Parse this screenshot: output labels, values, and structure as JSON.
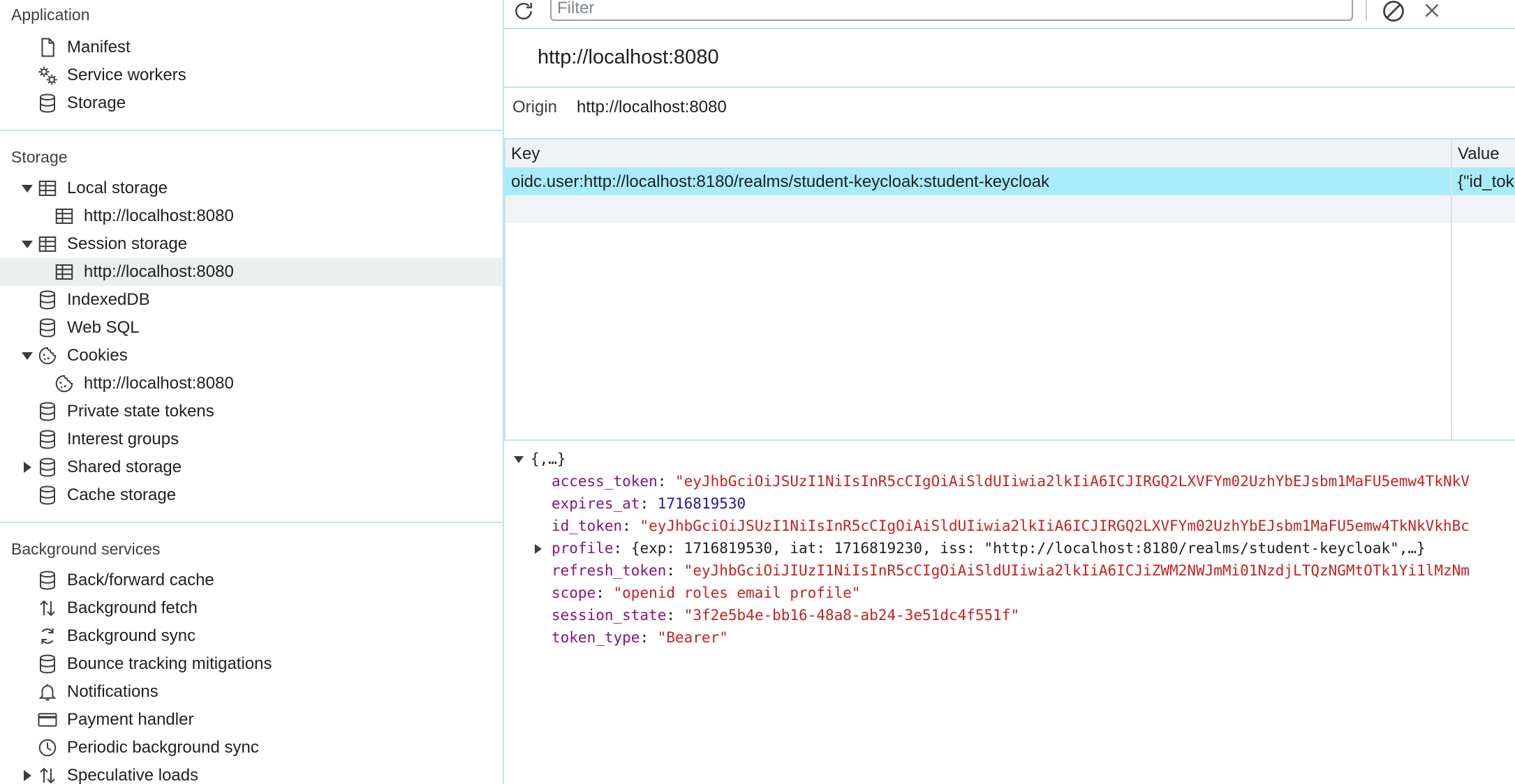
{
  "sidebar": {
    "application": {
      "title": "Application",
      "items": [
        {
          "label": "Manifest",
          "icon": "document-icon"
        },
        {
          "label": "Service workers",
          "icon": "gears-icon"
        },
        {
          "label": "Storage",
          "icon": "database-icon"
        }
      ]
    },
    "storage": {
      "title": "Storage",
      "local_storage": {
        "label": "Local storage",
        "child": "http://localhost:8080"
      },
      "session_storage": {
        "label": "Session storage",
        "child": "http://localhost:8080"
      },
      "indexeddb": "IndexedDB",
      "websql": "Web SQL",
      "cookies": {
        "label": "Cookies",
        "child": "http://localhost:8080"
      },
      "private_state_tokens": "Private state tokens",
      "interest_groups": "Interest groups",
      "shared_storage": "Shared storage",
      "cache_storage": "Cache storage"
    },
    "background": {
      "title": "Background services",
      "items": [
        {
          "label": "Back/forward cache",
          "icon": "database-icon"
        },
        {
          "label": "Background fetch",
          "icon": "updown-arrows-icon"
        },
        {
          "label": "Background sync",
          "icon": "sync-icon"
        },
        {
          "label": "Bounce tracking mitigations",
          "icon": "database-icon"
        },
        {
          "label": "Notifications",
          "icon": "bell-icon"
        },
        {
          "label": "Payment handler",
          "icon": "card-icon"
        },
        {
          "label": "Periodic background sync",
          "icon": "clock-icon"
        },
        {
          "label": "Speculative loads",
          "icon": "updown-arrows-icon"
        }
      ]
    }
  },
  "toolbar": {
    "filter_placeholder": "Filter"
  },
  "origin": {
    "title": "http://localhost:8080",
    "label": "Origin",
    "value": "http://localhost:8080"
  },
  "table": {
    "columns": {
      "key": "Key",
      "value": "Value"
    },
    "rows": [
      {
        "key": "oidc.user:http://localhost:8180/realms/student-keycloak:student-keycloak",
        "value": "{\"id_tok"
      }
    ]
  },
  "preview": {
    "root": "{,…}",
    "fields": [
      {
        "key": "access_token",
        "value": "\"eyJhbGciOiJSUzI1NiIsInR5cCIgOiAiSldUIiwia2lkIiA6ICJIRGQ2LXVFYm02UzhYbEJsbm1MaFU5emw4TkNkV",
        "type": "string",
        "expandable": false
      },
      {
        "key": "expires_at",
        "value": "1716819530",
        "type": "number",
        "expandable": false
      },
      {
        "key": "id_token",
        "value": "\"eyJhbGciOiJSUzI1NiIsInR5cCIgOiAiSldUIiwia2lkIiA6ICJIRGQ2LXVFYm02UzhYbEJsbm1MaFU5emw4TkNkVkhBc",
        "type": "string",
        "expandable": false
      },
      {
        "key": "profile",
        "value": "{exp: 1716819530, iat: 1716819230, iss: \"http://localhost:8180/realms/student-keycloak\",…}",
        "type": "object",
        "expandable": true
      },
      {
        "key": "refresh_token",
        "value": "\"eyJhbGciOiJIUzI1NiIsInR5cCIgOiAiSldUIiwia2lkIiA6ICJiZWM2NWJmMi01NzdjLTQzNGMtOTk1Yi1lMzNm",
        "type": "string",
        "expandable": false
      },
      {
        "key": "scope",
        "value": "\"openid roles email profile\"",
        "type": "string",
        "expandable": false
      },
      {
        "key": "session_state",
        "value": "\"3f2e5b4e-bb16-48a8-ab24-3e51dc4f551f\"",
        "type": "string",
        "expandable": false
      },
      {
        "key": "token_type",
        "value": "\"Bearer\"",
        "type": "string",
        "expandable": false
      }
    ]
  },
  "colors": {
    "accent_border": "#b9e6f3",
    "selected_row": "#a8ecfb",
    "json_key": "#881280",
    "json_string": "#c5221f",
    "json_number": "#1a1aa6"
  }
}
